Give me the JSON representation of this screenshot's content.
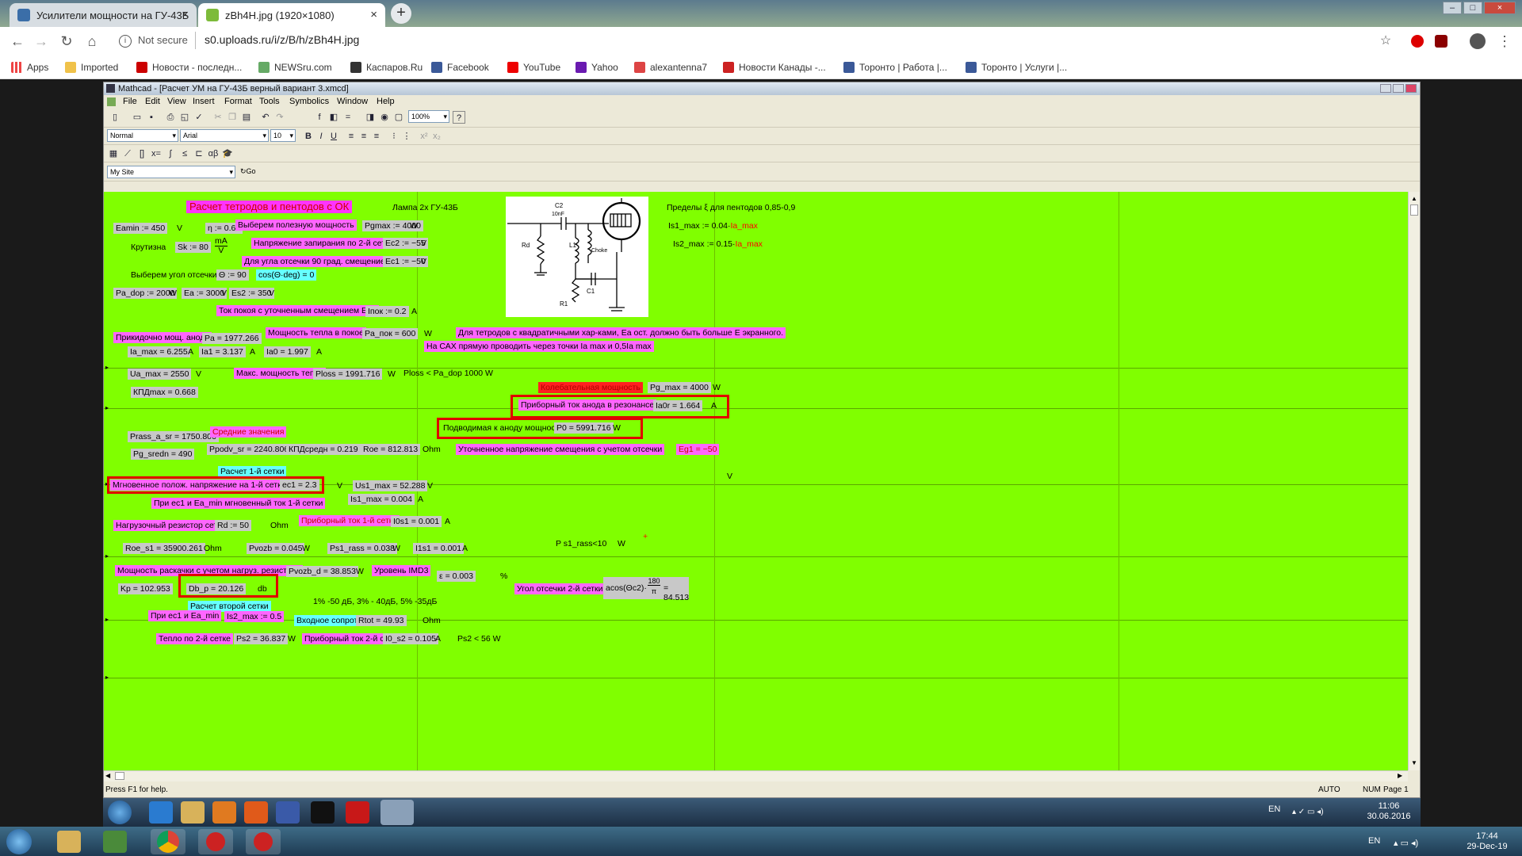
{
  "browser": {
    "tabs": [
      {
        "label": "Усилители мощности на ГУ-43Б"
      },
      {
        "label": "zBh4H.jpg (1920×1080)"
      }
    ],
    "security": "Not secure",
    "url": "s0.uploads.ru/i/z/B/h/zBh4H.jpg",
    "bookmarks": [
      "Apps",
      "Imported",
      "Новости - последн...",
      "NEWSru.com",
      "Каспаров.Ru",
      "Facebook",
      "YouTube",
      "Yahoo",
      "alexantenna7",
      "Новости Канады -...",
      "Торонто | Работа |...",
      "Торонто | Услуги |..."
    ]
  },
  "mathcad": {
    "title": "Mathcad - [Расчет УМ на ГУ-43Б  верный вариант 3.xmcd]",
    "menu": [
      "File",
      "Edit",
      "View",
      "Insert",
      "Format",
      "Tools",
      "Symbolics",
      "Window",
      "Help"
    ],
    "zoom": "100%",
    "style": "Normal",
    "font": "Arial",
    "size": "10",
    "site": "My Site",
    "go": "Go",
    "status_help": "Press F1 for help.",
    "status_auto": "AUTO",
    "status_num": "NUM",
    "status_page": "Page 1"
  },
  "sheet": {
    "title": "Расчет тетродов и пентодов с ОК",
    "lamp": "Лампа 2х ГУ-43Б",
    "limits": "Пределы ξ для пентодов  0,85-0,9",
    "is1max": "Is1_max := 0.04·",
    "is2max": "Is2_max := 0.15·",
    "ia_max_ref": "Ia_max",
    "eamin": "Eamin := 450",
    "v": "V",
    "eta": "η := 0.67",
    "choose_power": "Выберем полезную мощность",
    "pgmax": "Pgmax := 4000",
    "w": "W",
    "krutizna": "Крутизна",
    "sk": "Sk := 80",
    "ma": "mA",
    "lock_voltage": "Напряжение запирания по 2-й сетке",
    "ec2": "Ec2 := −55",
    "cut_angle_bias": "Для угла отсечки 90 град. смещение",
    "ec1": "Ec1 := −50",
    "choose_angle": "Выберем угол отсечки",
    "theta": "Θ := 90",
    "cos": "cos(Θ·deg) = 0",
    "padop": "Pa_dop := 2000",
    "ea": "Ea := 3000",
    "es2": "Es2 := 350",
    "rest_current": "Ток покоя с уточненным смещением Eg1",
    "ipok": "Iпок := 0.2",
    "a": "A",
    "anode_power": "Прикидочно мощ. анода",
    "pa": "Pa = 1977.266",
    "rest_heat": "Мощность тепла в покое",
    "papok": "Pa_пок = 600",
    "tetrode_note": "Для тетродов с квадратичными хар-ками, Ea ост. должно быть больше E экранного.",
    "cax_note": "На САХ прямую проводить через точки Ia max  и 0,5Ia max",
    "iamax": "Ia_max = 6.255",
    "ia1": "Ia1 = 3.137",
    "ia0": "Ia0 = 1.997",
    "uamax": "Ua_max = 2550",
    "max_heat": "Макс. мощность тепла",
    "ploss": "Ploss = 1991.716",
    "ploss_cmp": "Ploss < Pa_dop 1000 W",
    "kpd": "КПДmax = 0.668",
    "osc_power": "Колебательная мощность",
    "pgmax2": "Pg_max = 4000",
    "res_current": "Приборный ток анода  в резонансе",
    "ia0r": "Ia0r = 1.664",
    "supplied_power": "Подводимая к аноду мощность",
    "p0": "P0 = 5991.716",
    "prass": "Prass_a_sr = 1750.806",
    "avg": "Средние значения",
    "pgsredn": "Pg_sredn = 490",
    "ppodv": "Ppodv_sr = 2240.806",
    "kpdsr": "КПДсредн = 0.219",
    "roe": "Roe = 812.813",
    "ohm": "Ohm",
    "bias_note": "Уточненное напряжение смещения с учетом отсечки",
    "eg1": "Eg1 = −50",
    "grid1_calc": "Расчет 1-й сетки",
    "inst_voltage": "Мгновенное полож. напряжение на 1-й сетке",
    "ec1val": "ec1 = 2.3",
    "us1max": "Us1_max = 52.288",
    "is1maxval": "Is1_max = 0.004",
    "inst_current": "При ec1  и Ea_min мгновенный ток 1-й сетки",
    "load_res": "Нагрузочный резистор сетки",
    "rd": "Rd := 50",
    "grid1_dc": "Приборный ток 1-й сетки",
    "i0s1": "I0s1 = 0.001",
    "ps1note": "P s1_rass<10",
    "plus": "+",
    "roes1": "Roe_s1 = 35900.261",
    "pvozb": "Pvozb = 0.045",
    "ps1rass": "Ps1_rass = 0.038",
    "i1s1": "I1s1 = 0.001",
    "drive_power": "Мощность раскачки с учетом нагруз. резистора",
    "pvozbd": "Pvozb_d = 38.853",
    "imd": "Уровень IMD3",
    "eps": "ε = 0.003",
    "pct": "%",
    "kp": "Kp = 102.953",
    "dbp": "Db_p = 20.126",
    "db": "db",
    "imd_note": "1% -50 дБ, 3% - 40дБ, 5% -35дБ",
    "cut2": "Угол отсечки 2-й сетки",
    "acos_lhs": "acos(Θc2)·",
    "acos_num": "180",
    "acos_den": "π",
    "acos_res": "= 84.513",
    "grid2_calc": "Расчет второй сетки",
    "at_ec1": "При ec1 и Ea_min",
    "is2maxval": "Is2_max := 0.5",
    "input_res": "Входное сопрот.",
    "rtot": "Rtot = 49.93",
    "heat2": "Тепло по 2-й сетке",
    "ps2": "Ps2 = 36.837",
    "grid2_dc": "Приборный ток 2-й сетки",
    "i0s2": "I0_s2 = 0.105",
    "ps2cmp": "Ps2 < 56 W"
  },
  "circuit": {
    "c2": "C2",
    "c2val": "10nF",
    "rd": "Rd",
    "l1": "L1",
    "choke": "Choke",
    "c1": "C1",
    "r1": "R1"
  },
  "taskbar": {
    "inner_lang": "EN",
    "inner_time": "11:06",
    "inner_date": "30.06.2016",
    "outer_lang": "EN",
    "outer_time": "17:44",
    "outer_date": "29-Dec-19"
  }
}
